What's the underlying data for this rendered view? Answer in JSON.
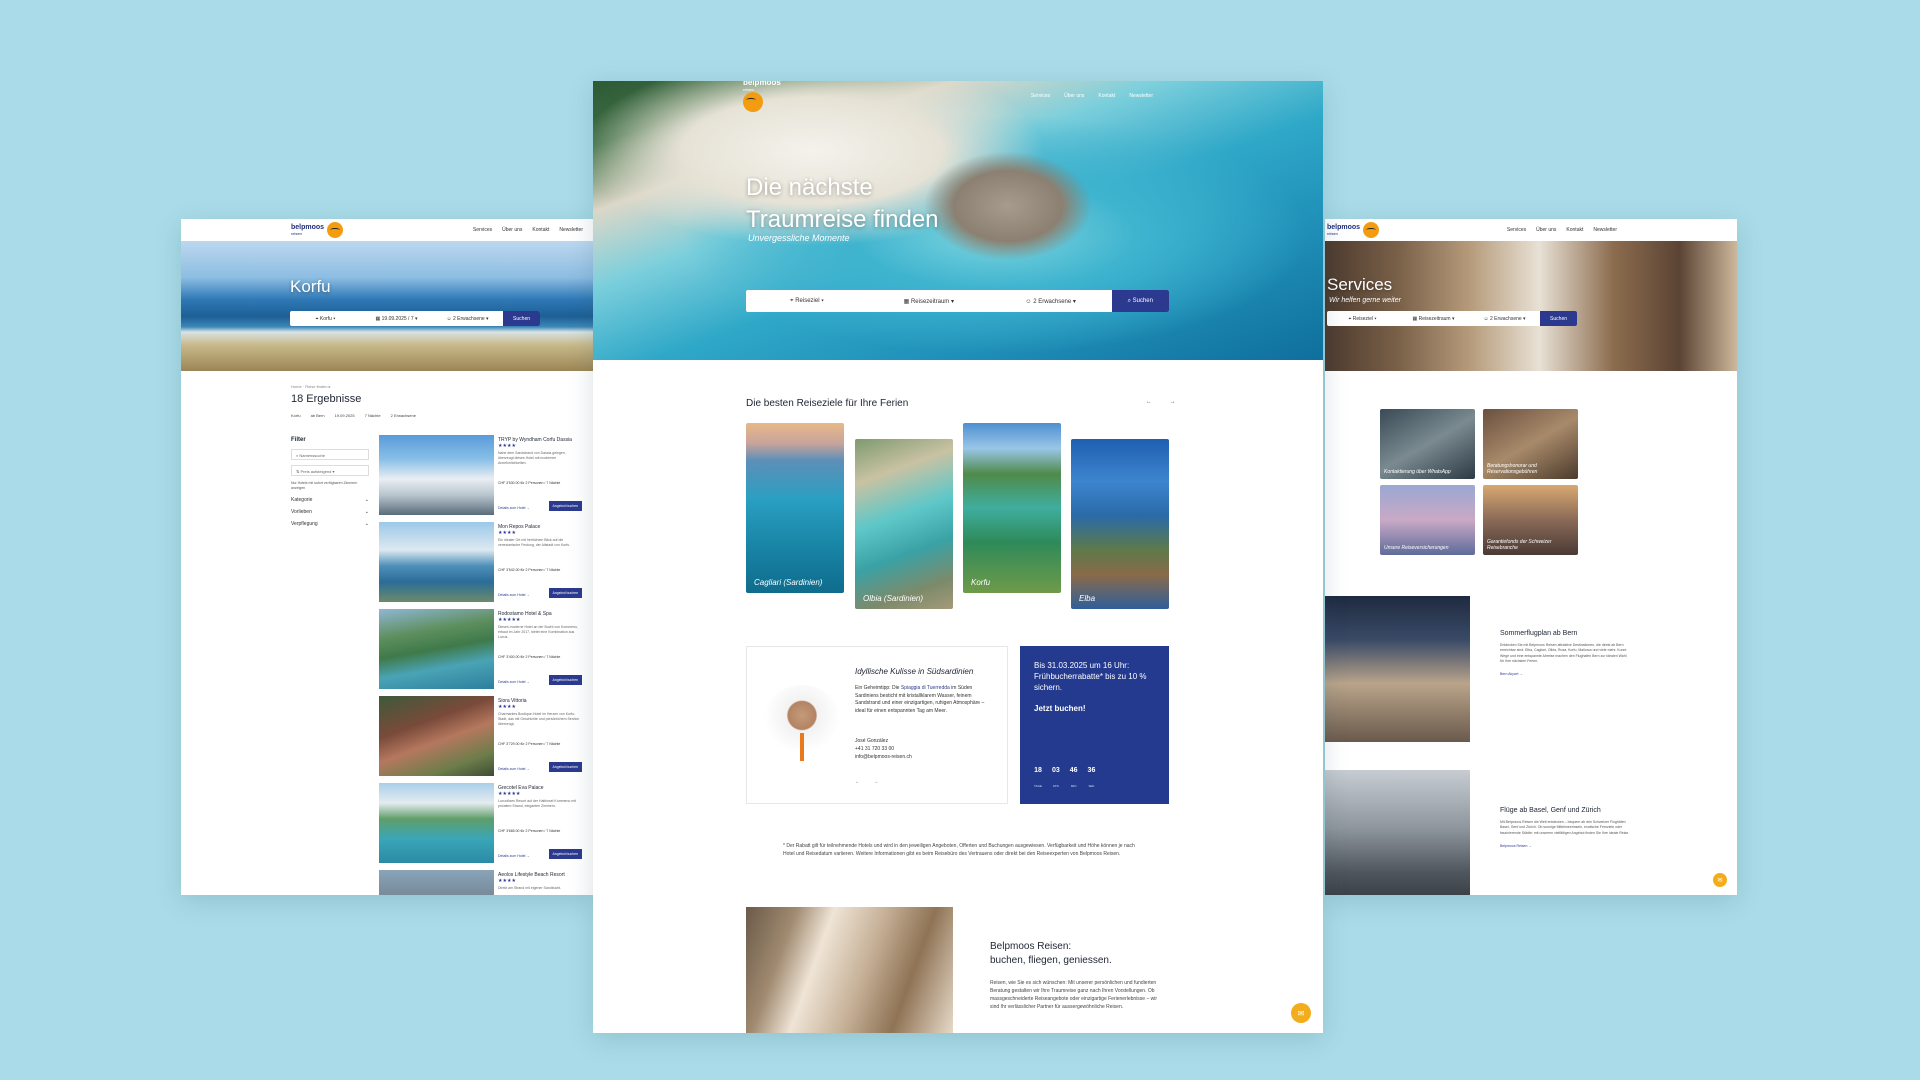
{
  "brand": {
    "name": "belpmoos",
    "sub": "reisen",
    "accent": "#f39c12",
    "primary": "#2b3a8f"
  },
  "nav": {
    "links": [
      "Services",
      "Über uns",
      "Kontakt",
      "Newsletter"
    ]
  },
  "search": {
    "destination": "Reiseziel",
    "dates": "Reisezeitraum",
    "guests": "2 Erwachsene",
    "button": "Suchen"
  },
  "left": {
    "hero_title": "Korfu",
    "search": {
      "destination": "Korfu",
      "dates": "19.09.2025 / 7",
      "guests": "2 Erwachsene",
      "button": "Suchen"
    },
    "breadcrumb": "Home · Reise finden ▸",
    "results": "18 Ergebnisse",
    "chips": [
      "Korfu",
      "ab Bern",
      "19.09.2025",
      "7 Nächte",
      "2 Erwachsene"
    ],
    "filter": {
      "title": "Filter",
      "name_search": "Namenssuche",
      "sort": "Preis aufsteigend",
      "note": "Nur Hotels mit sofort verfügbaren Zimmern anzeigen",
      "rows": [
        "Kategorie",
        "Vorlieben",
        "Verpflegung"
      ]
    },
    "hotels": [
      {
        "name": "TRYP by Wyndham Corfu Dassia",
        "stars": "★★★★",
        "desc": "Nahe dem Sandstrand von Dassia gelegen, überzeugt dieses Hotel mit modernen Annehmlichkeiten.",
        "price": "CHF 3'530.00 für 2 Personen / 7 Nächte",
        "link": "Details zum Hotel →",
        "button": "Angebot buchen"
      },
      {
        "name": "Mon Repos Palace",
        "stars": "★★★★",
        "desc": "Ein idealer Ort mit herrlichem Blick auf die venezianische Festung, der Altstadt von Korfu.",
        "price": "CHF 3'542.00 für 2 Personen / 7 Nächte",
        "link": "Details zum Hotel →",
        "button": "Angebot buchen"
      },
      {
        "name": "Rodostamo Hotel & Spa",
        "stars": "★★★★★",
        "desc": "Dieses moderne Hotel an der Bucht von Kommeno, erbaut im Jahr 2017, bietet eine Kombination aus Luxus.",
        "price": "CHF 3'400.00 für 2 Personen / 7 Nächte",
        "link": "Details zum Hotel →",
        "button": "Angebot buchen"
      },
      {
        "name": "Siora Vittoria",
        "stars": "★★★★",
        "desc": "Charmantes Boutique-Hotel im Herzen von Korfu-Stadt, das mit Geschichte und persönlichem Service überzeugt.",
        "price": "CHF 3'729.00 für 2 Personen / 7 Nächte",
        "link": "Details zum Hotel →",
        "button": "Angebot buchen"
      },
      {
        "name": "Grecotel Eva Palace",
        "stars": "★★★★★",
        "desc": "Luxuriöses Resort auf der Halbinsel Kommeno mit privatem Strand, eleganten Zimmern.",
        "price": "CHF 3'665.00 für 2 Personen / 7 Nächte",
        "link": "Details zum Hotel →",
        "button": "Angebot buchen"
      },
      {
        "name": "Aeolos Lifestyle Beach Resort",
        "stars": "★★★★",
        "desc": "Direkt am Strand mit eigener Sandbucht.",
        "price": "",
        "link": "",
        "button": ""
      }
    ]
  },
  "center": {
    "title_line1": "Die nächste",
    "title_line2": "Traumreise finden",
    "subtitle": "Unvergessliche Momente",
    "section_title": "Die besten Reiseziele für Ihre Ferien",
    "arrows": "← →",
    "destinations": [
      "Cagliari (Sardinien)",
      "Olbia (Sardinien)",
      "Korfu",
      "Elba"
    ],
    "contact": {
      "title": "Idyllische Kulisse in Südsardinien",
      "text_pre": "Ein Geheimtipp: Die ",
      "text_highlight": "Spiaggia di Tuerredda",
      "text_post": " im Süden Sardiniens besticht mit kristallklarem Wasser, feinem Sandstrand und einer einzigartigen, ruhigen Atmosphäre – ideal für einen entspannten Tag am Meer.",
      "name": "José González",
      "phone": "+41 31 720 33 00",
      "email": "info@belpmoos-reisen.ch",
      "arrows": "← →"
    },
    "promo": {
      "text": "Bis 31.03.2025 um 16 Uhr: Frühbucherrabatte* bis zu 10 % sichern.",
      "cta": "Jetzt buchen!",
      "countdown": [
        {
          "value": "18",
          "unit": "TAGE"
        },
        {
          "value": "03",
          "unit": "STD"
        },
        {
          "value": "46",
          "unit": "MIN"
        },
        {
          "value": "36",
          "unit": "SEK"
        }
      ]
    },
    "disclaimer": "* Der Rabatt gilt für teilnehmende Hotels und wird in den jeweiligen Angeboten, Offerten und Buchungen ausgewiesen. Verfügbarkeit und Höhe können je nach Hotel und Reisedatum variieren. Weitere Informationen gibt es beim Reisebüro des Vertrauens oder direkt bei den Reiseexperten von Belpmoos Reisen.",
    "about_title_1": "Belpmoos Reisen:",
    "about_title_2": "buchen, fliegen, geniessen.",
    "about_text": "Reisen, wie Sie es sich wünschen: Mit unserer persönlichen und fundierten Beratung gestalten wir Ihre Traumreise ganz nach Ihren Vorstellungen. Ob massgeschneiderte Reiseangebote oder einzigartige Ferienerlebnisse – wir sind Ihr verlässlicher Partner für aussergewöhnliche Reisen."
  },
  "right": {
    "hero_title": "Services",
    "hero_sub": "Wir helfen gerne weiter",
    "search": {
      "destination": "Reiseziel",
      "dates": "Reisezeitraum",
      "guests": "2 Erwachsene",
      "button": "Suchen"
    },
    "services": [
      "Kontaktierung über WhatsApp",
      "Beratungshonorar und Reservationsgebühren",
      "Unsere Reiseversicherungen",
      "Garantiefonds der Schweizer Reisebranche"
    ],
    "block1": {
      "title": "Sommerflugplan ab Bern",
      "text": "Entdecken Sie mit Belpmoos Reisen attraktive Destinationen, die direkt ab Bern erreichbar sind: Elba, Cagliari, Olbia, Rosa, Korfu, Mallorca und viele mehr. Kurze Wege und eine entspannte Abreise machen den Flughafen Bern zur idealen Wahl für Ihre nächsten Ferien.",
      "link": "Bern Airport →"
    },
    "block2": {
      "title": "Flüge ab Basel, Genf und Zürich",
      "text": "Mit Belpmoos Reisen die Welt entdecken – bequem ab den Schweizer Flughäfen Basel, Genf und Zürich. Ob sonnige Mittelmeerinseln, exotische Fernziele oder faszinierende Städte: mit unserem vielfältigen Angebot finden Sie Ihre ideale Reise.",
      "link": "Belpmoos Reisen →"
    }
  }
}
